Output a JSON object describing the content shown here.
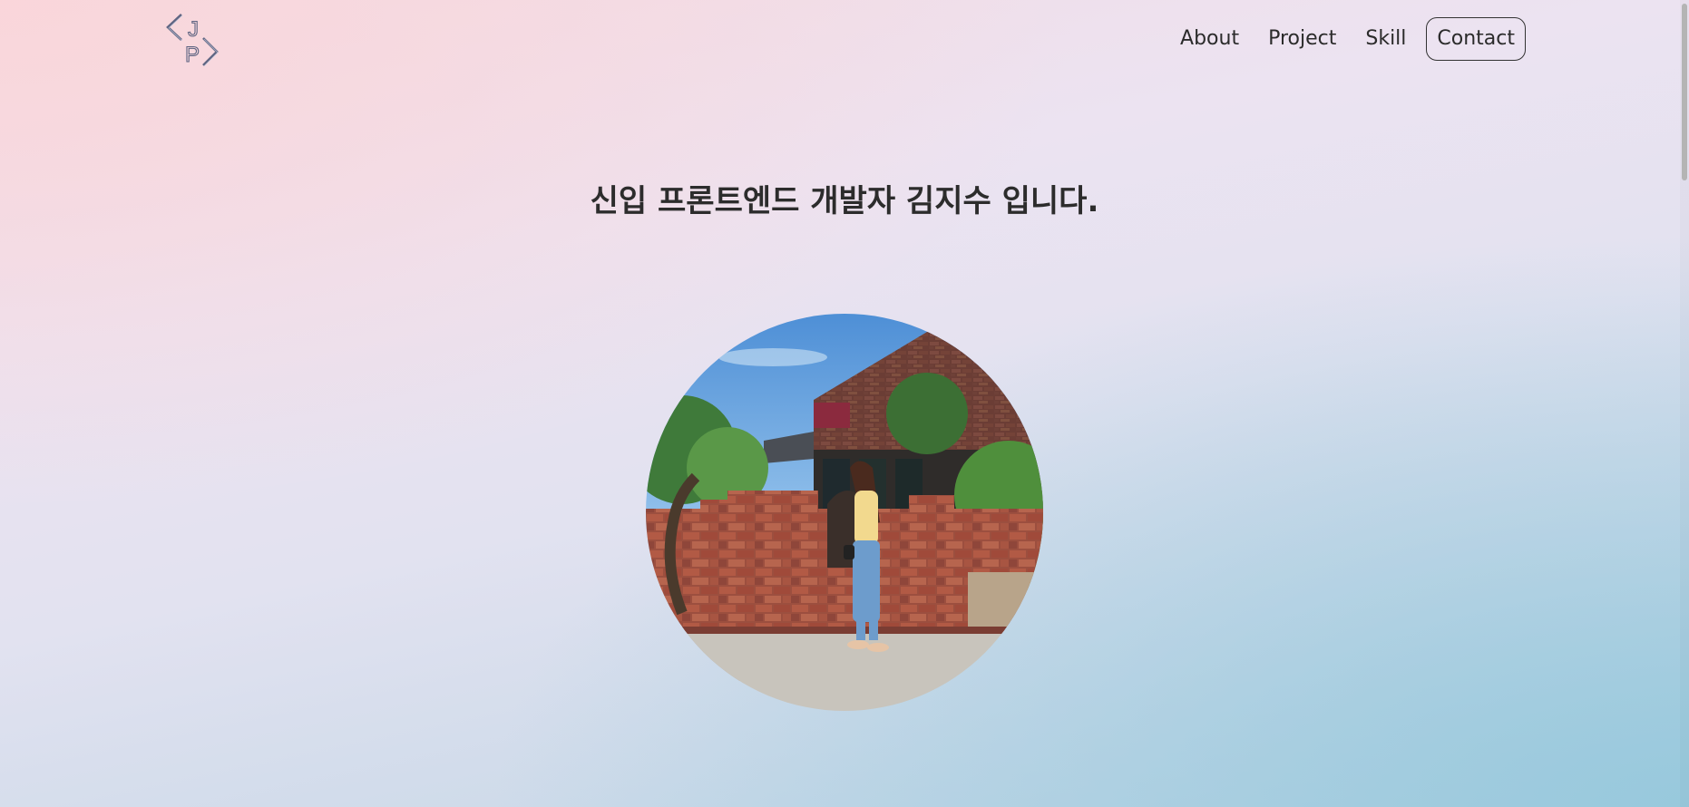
{
  "header": {
    "logo": {
      "letters": [
        "J",
        "P"
      ],
      "icon": "code-brackets-logo"
    },
    "nav": [
      {
        "label": "About"
      },
      {
        "label": "Project"
      },
      {
        "label": "Skill"
      },
      {
        "label": "Contact"
      }
    ]
  },
  "hero": {
    "headline": "신입 프론트엔드 개발자 김지수 입니다.",
    "photo": {
      "icon": "profile-photo",
      "description": "woman standing in front of brick wall and building"
    }
  },
  "colors": {
    "text": "#2c2c2c",
    "logo": "#5a607a",
    "gradient_top_left": "#f6d7dd",
    "gradient_bottom_right": "#9fcde0"
  }
}
